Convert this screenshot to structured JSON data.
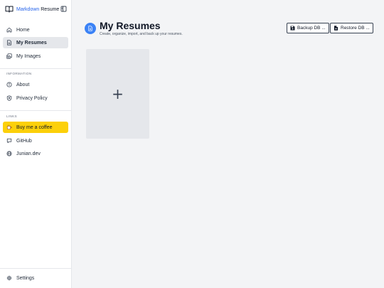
{
  "sidebar": {
    "brand": {
      "accent": "Markdown",
      "rest": " Resume"
    },
    "nav": [
      {
        "label": "Home",
        "icon": "home-icon"
      },
      {
        "label": "My Resumes",
        "icon": "document-icon",
        "active": true
      },
      {
        "label": "My Images",
        "icon": "images-icon"
      }
    ],
    "sections": {
      "information": "INFORMATION",
      "links": "LINKS"
    },
    "info_items": [
      {
        "label": "About",
        "icon": "info-icon"
      },
      {
        "label": "Privacy Policy",
        "icon": "shield-icon"
      }
    ],
    "link_items": [
      {
        "label": "Buy me a coffee",
        "icon": "coffee-icon"
      },
      {
        "label": "GitHub",
        "icon": "github-icon"
      },
      {
        "label": "Junian.dev",
        "icon": "globe-icon"
      }
    ],
    "settings": {
      "label": "Settings",
      "icon": "gear-icon"
    }
  },
  "main": {
    "title": "My Resumes",
    "subtitle": "Create, organize, import, and back up your resumes.",
    "backup_label": "Backup DB ...",
    "restore_label": "Restore DB ...",
    "new_card_symbol": "+"
  },
  "colors": {
    "accent": "#2563eb",
    "coffee": "#fcd00a",
    "active_bg": "#e5e7eb",
    "page_bg": "#f3f4f6"
  }
}
